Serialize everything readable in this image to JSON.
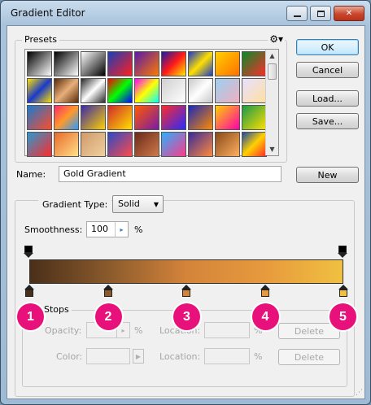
{
  "window": {
    "title": "Gradient Editor",
    "minimize_label": "minimize",
    "maximize_label": "maximize",
    "close_label": "✕"
  },
  "presets": {
    "label": "Presets",
    "menu_icon": "gear-icon",
    "swatches": [
      "linear-gradient(135deg,#000,#fff)",
      "linear-gradient(135deg,#000,#fff)",
      "linear-gradient(135deg,#fff,#000)",
      "linear-gradient(135deg,#1b3fb8,#ff1e1e)",
      "linear-gradient(135deg,#5a1aa8,#ff7a00)",
      "linear-gradient(135deg,#1a1aa8,#ff1a1a,#ffea00)",
      "linear-gradient(135deg,#1a3ac8,#ffe000,#1a3ac8)",
      "linear-gradient(135deg,#ffd000,#ff7000)",
      "linear-gradient(135deg,#0a8a2a,#ff2a2a)",
      "linear-gradient(135deg,#ffe000,#1a3ac8,#ffe000)",
      "linear-gradient(135deg,#5a2a0a,#e8b07a,#5a2a0a)",
      "linear-gradient(135deg,#2a2a2a,#fff,#2a2a2a)",
      "linear-gradient(135deg,#ff0000,#00ff00,#0000ff)",
      "linear-gradient(135deg,#ff00ff,#ffff00,#00ffff)",
      "linear-gradient(135deg,#d0d0d0,#fff)",
      "linear-gradient(135deg,#c8c8c8,#fff,#c8c8c8)",
      "linear-gradient(135deg,#9ad0f0,#f0b0c0)",
      "linear-gradient(135deg,#e8e0ff,#ffe0a0)",
      "linear-gradient(135deg,#1a7ad0,#ff4a2a)",
      "linear-gradient(135deg,#ff2a6a,#ff9a2a,#2a9aff)",
      "linear-gradient(135deg,#3a2aa8,#ffd000)",
      "linear-gradient(135deg,#d02a2a,#ffe000)",
      "linear-gradient(135deg,#ff5a00,#7a1aa8)",
      "linear-gradient(135deg,#ff2a2a,#2a2aff)",
      "linear-gradient(135deg,#1a2ab8,#ff8a00)",
      "linear-gradient(135deg,#ffd000,#ff00aa)",
      "linear-gradient(135deg,#1a9a4a,#ffe000)",
      "linear-gradient(135deg,#2a9ad0,#ff2a2a)",
      "linear-gradient(135deg,#e86a2a,#ffe08a)",
      "linear-gradient(135deg,#d09a6a,#f0d0a0)",
      "linear-gradient(135deg,#2a4ac8,#ff4a4a)",
      "linear-gradient(135deg,#6a2a1a,#d07a4a)",
      "linear-gradient(135deg,#2ab0ff,#ff3a8a)",
      "linear-gradient(135deg,#3a2a9a,#ff8a3a)",
      "linear-gradient(135deg,#8a4a1a,#ffb060)",
      "linear-gradient(135deg,#1a4aa8,#ffd000,#ff2a2a)"
    ]
  },
  "actions": {
    "ok_label": "OK",
    "cancel_label": "Cancel",
    "load_label": "Load...",
    "save_label": "Save...",
    "new_label": "New"
  },
  "name_field": {
    "label": "Name:",
    "value": "Gold Gradient"
  },
  "gradient_type": {
    "label": "Gradient Type:",
    "value": "Solid"
  },
  "smoothness": {
    "label": "Smoothness:",
    "value": "100",
    "unit": "%"
  },
  "gradient": {
    "stops": [
      {
        "color": "#4a2f19",
        "badge": "1"
      },
      {
        "color": "#8a5a2c",
        "badge": "2"
      },
      {
        "color": "#d4843a",
        "badge": "3"
      },
      {
        "color": "#e79a3d",
        "badge": "4"
      },
      {
        "color": "#f0c040",
        "badge": "5"
      }
    ],
    "opacity_stops": [
      {
        "color": "#000000"
      },
      {
        "color": "#000000"
      }
    ]
  },
  "stops_group": {
    "label": "Stops",
    "opacity_label": "Opacity:",
    "opacity_unit": "%",
    "location_label_1": "Location:",
    "location_unit_1": "%",
    "delete_label_1": "Delete",
    "color_label": "Color:",
    "location_label_2": "Location:",
    "location_unit_2": "%",
    "delete_label_2": "Delete"
  }
}
